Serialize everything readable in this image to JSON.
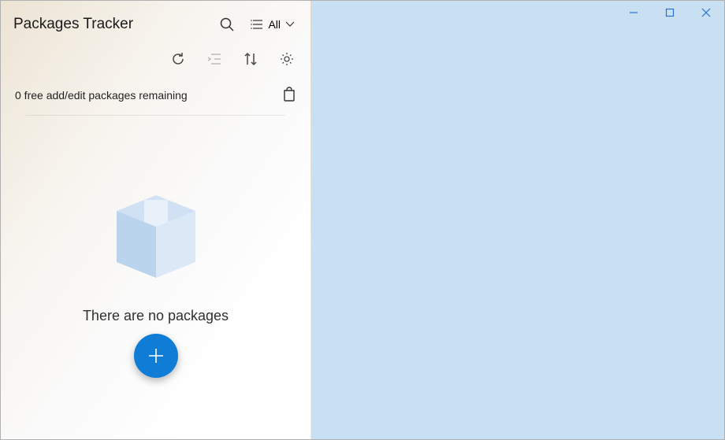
{
  "app": {
    "title": "Packages Tracker"
  },
  "filter": {
    "label": "All"
  },
  "status": {
    "free_remaining_text": "0 free add/edit packages remaining"
  },
  "empty": {
    "message": "There are no packages"
  },
  "colors": {
    "accent": "#0f7cd6",
    "right_panel_bg": "#c9e0f2"
  }
}
